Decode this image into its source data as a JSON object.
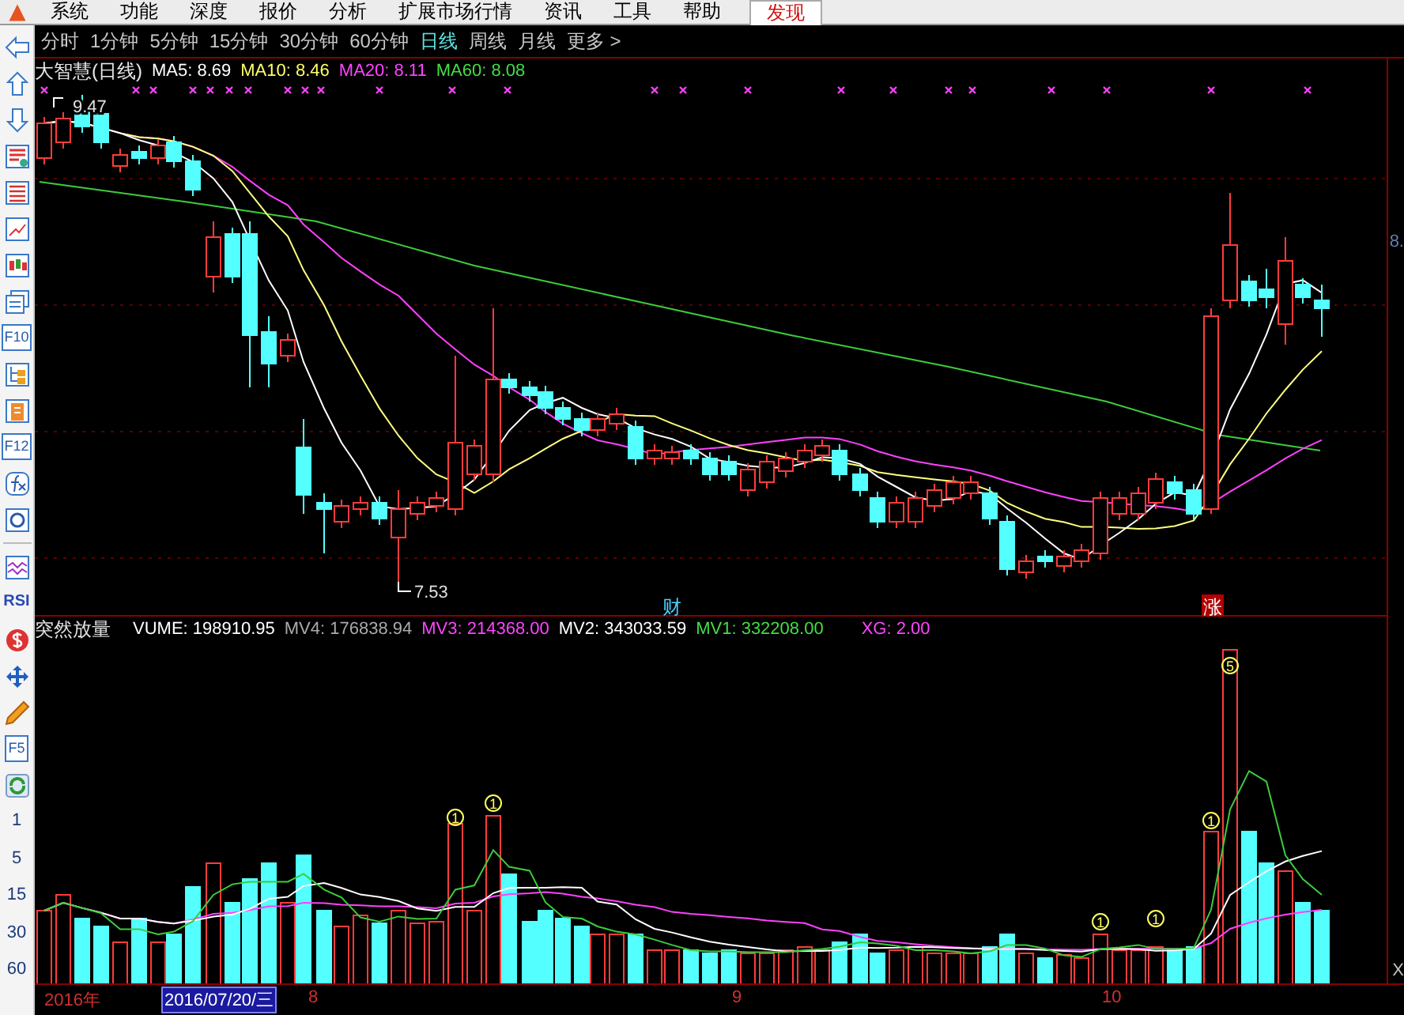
{
  "menu_bar": {
    "items": [
      {
        "label": "系统",
        "selected": false
      },
      {
        "label": "功能",
        "selected": false
      },
      {
        "label": "深度",
        "selected": false
      },
      {
        "label": "报价",
        "selected": false
      },
      {
        "label": "分析",
        "selected": false
      },
      {
        "label": "扩展市场行情",
        "selected": false
      },
      {
        "label": "资讯",
        "selected": false
      },
      {
        "label": "工具",
        "selected": false
      },
      {
        "label": "帮助",
        "selected": false
      },
      {
        "label": "发现",
        "selected": true
      }
    ]
  },
  "sidebar": {
    "items": [
      {
        "kind": "icon"
      },
      {
        "kind": "icon"
      },
      {
        "kind": "icon"
      },
      {
        "kind": "icon"
      },
      {
        "kind": "icon"
      },
      {
        "kind": "icon"
      },
      {
        "kind": "icon"
      },
      {
        "kind": "icon"
      },
      {
        "kind": "label",
        "label": "F10"
      },
      {
        "kind": "icon"
      },
      {
        "kind": "icon"
      },
      {
        "kind": "label",
        "label": "F12"
      },
      {
        "kind": "icon"
      },
      {
        "kind": "icon"
      },
      {
        "kind": "divider"
      },
      {
        "kind": "icon"
      },
      {
        "kind": "label",
        "label": "RSI"
      },
      {
        "kind": "icon"
      },
      {
        "kind": "icon"
      },
      {
        "kind": "icon"
      },
      {
        "kind": "label",
        "label": "F5"
      },
      {
        "kind": "icon"
      }
    ],
    "numbers": [
      "1",
      "5",
      "15",
      "30",
      "60"
    ]
  },
  "periods": [
    {
      "label": "分时",
      "selected": false
    },
    {
      "label": "1分钟",
      "selected": false
    },
    {
      "label": "5分钟",
      "selected": false
    },
    {
      "label": "15分钟",
      "selected": false
    },
    {
      "label": "30分钟",
      "selected": false
    },
    {
      "label": "60分钟",
      "selected": false
    },
    {
      "label": "日线",
      "selected": true
    },
    {
      "label": "周线",
      "selected": false
    },
    {
      "label": "月线",
      "selected": false
    },
    {
      "label": "更多 >",
      "selected": false
    }
  ],
  "price_chart": {
    "title": "大智慧(日线)",
    "legend": [
      {
        "text": "MA5: 8.69",
        "color": "#ffffff"
      },
      {
        "text": "MA10: 8.46",
        "color": "#ffff66"
      },
      {
        "text": "MA20: 8.11",
        "color": "#ff44ff"
      },
      {
        "text": "MA60: 8.08",
        "color": "#44dd44"
      }
    ],
    "high_label": "9.47",
    "low_label": "7.53",
    "axis_label": "8.",
    "event_markers": [
      {
        "label": "财",
        "kind": "news"
      },
      {
        "label": "涨",
        "kind": "limit-up"
      }
    ]
  },
  "volume_chart": {
    "title": "突然放量",
    "legend": [
      {
        "text": "VUME: 198910.95",
        "color": "#ffffff"
      },
      {
        "text": "MV4: 176838.94",
        "color": "#aaaaaa"
      },
      {
        "text": "MV3: 214368.00",
        "color": "#ff44ff"
      },
      {
        "text": "MV2: 343033.59",
        "color": "#ffffff"
      },
      {
        "text": "MV1: 332208.00",
        "color": "#44dd44"
      },
      {
        "text": "XG: 2.00",
        "color": "#ff44ff"
      }
    ],
    "signal_markers": [
      {
        "label": "1"
      },
      {
        "label": "1"
      },
      {
        "label": "1"
      },
      {
        "label": "1"
      },
      {
        "label": "1"
      },
      {
        "label": "5"
      }
    ],
    "close_label": "X"
  },
  "time_axis": {
    "year": "2016年",
    "cursor_date": "2016/07/20/三",
    "months": [
      "8",
      "9",
      "10"
    ]
  }
}
